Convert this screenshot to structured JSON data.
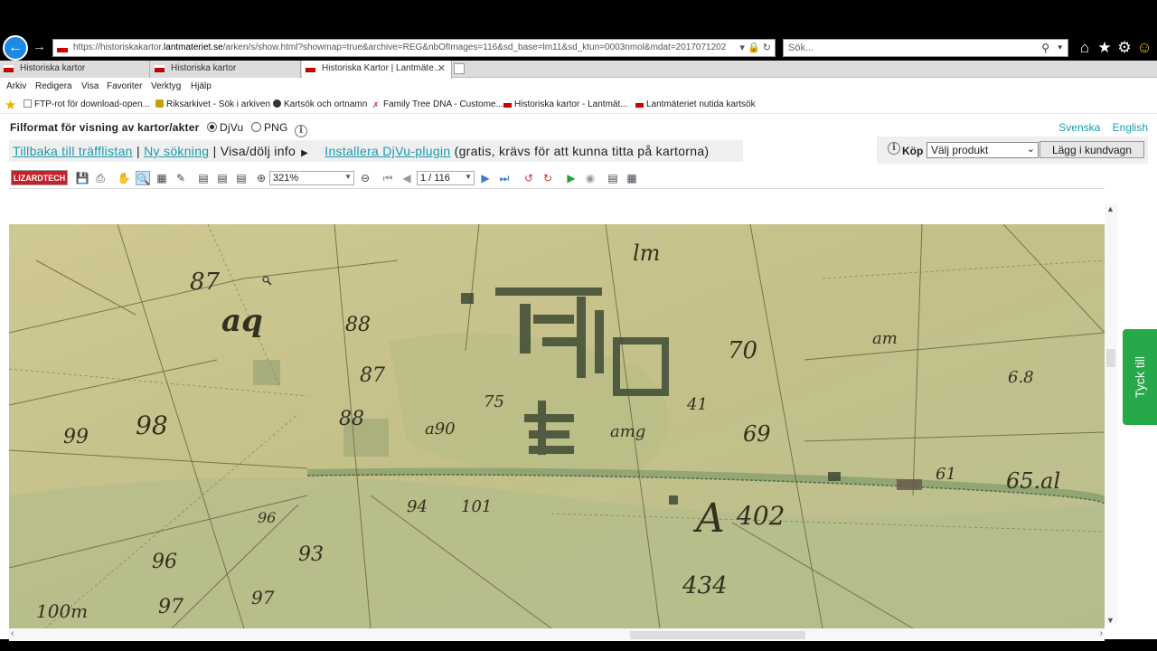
{
  "browser": {
    "url_prefix": "https://historiskakartor.",
    "url_host": "lantmateriet.se",
    "url_rest": "/arken/s/show.html?showmap=true&archive=REG&nbOfImages=116&sd_base=lm11&sd_ktun=0003nmol&mdat=2017071202",
    "search_placeholder": "Sök...",
    "tabs": [
      {
        "label": "Historiska kartor",
        "active": false
      },
      {
        "label": "Historiska kartor",
        "active": false
      },
      {
        "label": "Historiska Kartor | Lantmäte...",
        "active": true
      }
    ],
    "menu": [
      "Arkiv",
      "Redigera",
      "Visa",
      "Favoriter",
      "Verktyg",
      "Hjälp"
    ],
    "favorites": [
      "FTP-rot för download-open...",
      "Riksarkivet - Sök i arkiven",
      "Kartsök och ortnamn",
      "Family Tree DNA - Custome...",
      "Historiska kartor - Lantmät...",
      "Lantmäteriet nutida kartsök"
    ]
  },
  "page": {
    "format_label": "Filformat för visning av kartor/akter",
    "format_djvu": "DjVu",
    "format_png": "PNG",
    "format_selected": "DjVu",
    "lang_sv": "Svenska",
    "lang_en": "English",
    "nav_back": "Tillbaka till träfflistan",
    "nav_sep": "|",
    "nav_new": "Ny sökning",
    "nav_toggle": "Visa/dölj info",
    "nav_install": "Installera DjVu-plugin",
    "nav_install_note": "(gratis, krävs för att kunna titta på kartorna)",
    "buy_label": "Köp",
    "buy_select": "Välj produkt",
    "buy_button": "Lägg i kundvagn",
    "feedback": "Tyck till"
  },
  "viewer": {
    "logo": "LIZARDTECH",
    "zoom": "321%",
    "page_indicator": "1 / 116",
    "map_labels": [
      "87",
      "aq",
      "88",
      "87",
      "88",
      "98",
      "99",
      "97",
      "93",
      "96",
      "96",
      "97",
      "94",
      "100m",
      "70",
      "69",
      "65.al",
      "6.8",
      "A",
      "402",
      "434",
      "lm",
      "am",
      "amg",
      "a90",
      "101",
      "75",
      "41",
      "61"
    ]
  },
  "colors": {
    "link": "#1a9bb0",
    "feedback_bg": "#27a94a",
    "map_bg": "#c8c28e",
    "logo_bg": "#c8202a"
  }
}
